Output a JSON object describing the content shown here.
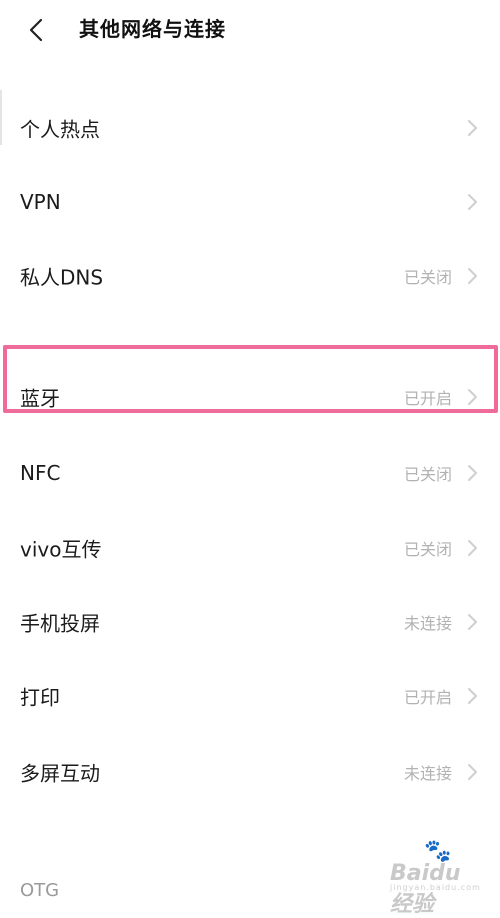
{
  "header": {
    "title": "其他网络与连接",
    "back_icon": "chevron-left-icon"
  },
  "items": [
    {
      "label": "个人热点",
      "status": ""
    },
    {
      "label": "VPN",
      "status": ""
    },
    {
      "label": "私人DNS",
      "status": "已关闭"
    },
    {
      "label": "蓝牙",
      "status": "已开启"
    },
    {
      "label": "NFC",
      "status": "已关闭"
    },
    {
      "label": "vivo互传",
      "status": "已关闭"
    },
    {
      "label": "手机投屏",
      "status": "未连接"
    },
    {
      "label": "打印",
      "status": "已开启"
    },
    {
      "label": "多屏互动",
      "status": "未连接"
    }
  ],
  "footer": {
    "partial_item": "OTG"
  },
  "watermark": {
    "text": "Baidu经验",
    "sub": "jingyan.baidu.com"
  },
  "colors": {
    "highlight": "#ef6b9a",
    "status_text": "#b2b2b2",
    "chevron": "#cfcfcf"
  }
}
